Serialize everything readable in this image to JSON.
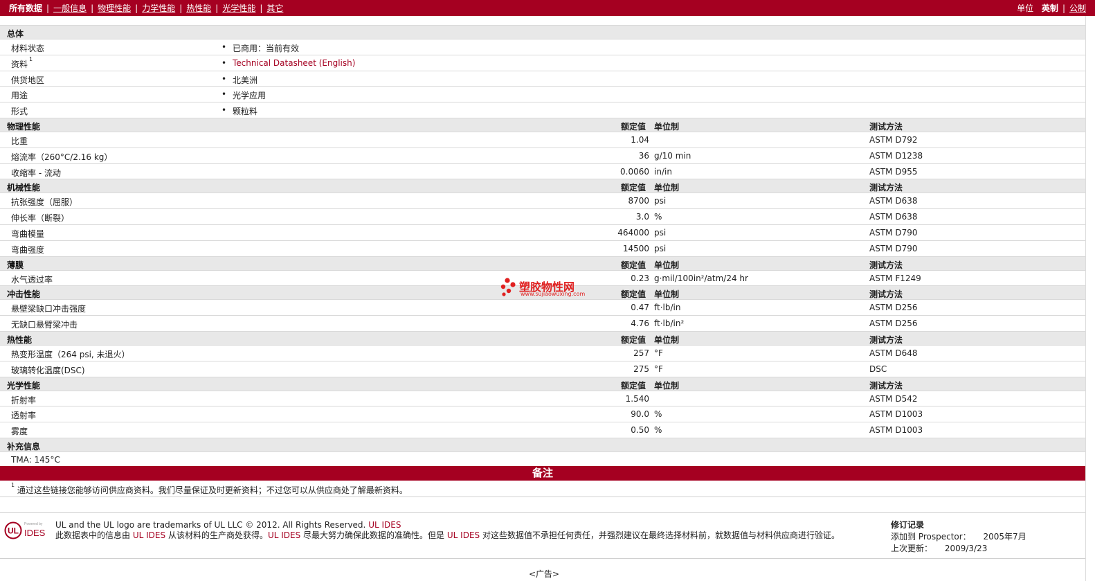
{
  "nav": {
    "tabs": [
      "所有数据",
      "一般信息",
      "物理性能",
      "力学性能",
      "热性能",
      "光学性能",
      "其它"
    ],
    "unit_label": "单位",
    "unit_imperial": "英制",
    "unit_metric": "公制"
  },
  "columns": {
    "value": "额定值",
    "unit": "单位制",
    "test": "测试方法"
  },
  "general": {
    "title": "总体",
    "rows": [
      {
        "name": "材料状态",
        "value": "已商用：当前有效"
      },
      {
        "name": "资料",
        "sup": "1",
        "value": "Technical Datasheet (English)"
      },
      {
        "name": "供货地区",
        "value": "北美洲"
      },
      {
        "name": "用途",
        "value": "光学应用"
      },
      {
        "name": "形式",
        "value": "颗粒料"
      }
    ]
  },
  "sections": [
    {
      "title": "物理性能",
      "rows": [
        {
          "name": "比重",
          "value": "1.04",
          "unit": "",
          "test": "ASTM D792"
        },
        {
          "name": "熔流率（260°C/2.16 kg）",
          "value": "36",
          "unit": "g/10 min",
          "test": "ASTM D1238"
        },
        {
          "name": "收缩率 - 流动",
          "value": "0.0060",
          "unit": "in/in",
          "test": "ASTM D955"
        }
      ]
    },
    {
      "title": "机械性能",
      "rows": [
        {
          "name": "抗张强度（屈服）",
          "value": "8700",
          "unit": "psi",
          "test": "ASTM D638"
        },
        {
          "name": "伸长率（断裂）",
          "value": "3.0",
          "unit": "%",
          "test": "ASTM D638"
        },
        {
          "name": "弯曲模量",
          "value": "464000",
          "unit": "psi",
          "test": "ASTM D790"
        },
        {
          "name": "弯曲强度",
          "value": "14500",
          "unit": "psi",
          "test": "ASTM D790"
        }
      ]
    },
    {
      "title": "薄膜",
      "rows": [
        {
          "name": "水气透过率",
          "value": "0.23",
          "unit": "g·mil/100in²/atm/24 hr",
          "test": "ASTM F1249"
        }
      ]
    },
    {
      "title": "冲击性能",
      "rows": [
        {
          "name": "悬壁梁缺口冲击强度",
          "value": "0.47",
          "unit": "ft·lb/in",
          "test": "ASTM D256"
        },
        {
          "name": "无缺口悬臂梁冲击",
          "value": "4.76",
          "unit": "ft·lb/in²",
          "test": "ASTM D256"
        }
      ]
    },
    {
      "title": "热性能",
      "rows": [
        {
          "name": "热变形温度（264 psi, 未退火）",
          "value": "257",
          "unit": "°F",
          "test": "ASTM D648"
        },
        {
          "name": "玻璃转化温度(DSC)",
          "value": "275",
          "unit": "°F",
          "test": "DSC"
        }
      ]
    },
    {
      "title": "光学性能",
      "rows": [
        {
          "name": "折射率",
          "value": "1.540",
          "unit": "",
          "test": "ASTM D542"
        },
        {
          "name": "透射率",
          "value": "90.0",
          "unit": "%",
          "test": "ASTM D1003"
        },
        {
          "name": "雾度",
          "value": "0.50",
          "unit": "%",
          "test": "ASTM D1003"
        }
      ]
    }
  ],
  "supplement": {
    "title": "补充信息",
    "text": "TMA: 145°C"
  },
  "notes": {
    "title": "备注",
    "sup": "1",
    "text": "通过这些链接您能够访问供应商资料。我们尽量保证及时更新资料；不过您可以从供应商处了解最新资料。"
  },
  "footer": {
    "logo_top": "Powered by",
    "logo_text": "IDES",
    "trademark": "UL and the UL logo are trademarks of UL LLC © 2012. All Rights Reserved.",
    "trademark_link": "UL IDES",
    "disclaimer_a": "此数据表中的信息由",
    "disclaimer_link1": "UL IDES",
    "disclaimer_b": "从该材料的生产商处获得。",
    "disclaimer_link2": "UL IDES",
    "disclaimer_c": "尽最大努力确保此数据的准确性。但是",
    "disclaimer_link3": "UL IDES",
    "disclaimer_d": "对这些数据值不承担任何责任，并强烈建议在最终选择材料前，就数据值与材料供应商进行验证。",
    "rev_title": "修订记录",
    "added_label": "添加到 Prospector：",
    "added_value": "2005年7月",
    "updated_label": "上次更新：",
    "updated_value": "2009/3/23",
    "ad": "<广告>"
  },
  "watermark": {
    "name": "塑胶物性网",
    "url": "www.sujiaowuxing.com"
  },
  "colors": {
    "brand": "#a50021",
    "header_row": "#e8e8e8"
  }
}
